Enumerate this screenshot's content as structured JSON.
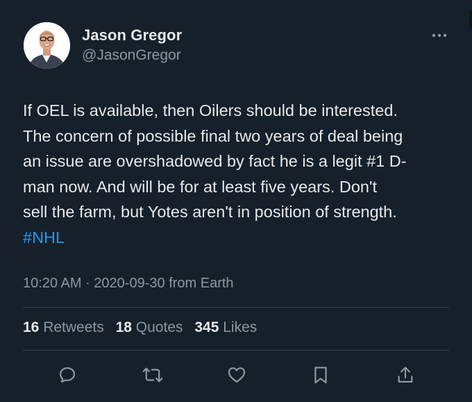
{
  "author": {
    "display_name": "Jason Gregor",
    "handle": "@JasonGregor"
  },
  "tweet": {
    "lines": [
      "If OEL is available, then Oilers should be interested.",
      "The concern of possible final two years of deal being",
      "an issue are overshadowed by fact he is a legit #1 D-",
      "man now. And will be for at least five years. Don't",
      "sell the farm, but Yotes aren't in position of strength."
    ],
    "hashtag": "#NHL"
  },
  "meta": {
    "time": "10:20 AM",
    "separator": "·",
    "date": "2020-09-30",
    "source": "from Earth"
  },
  "stats": {
    "retweets_count": "16",
    "retweets_label": "Retweets",
    "quotes_count": "18",
    "quotes_label": "Quotes",
    "likes_count": "345",
    "likes_label": "Likes"
  },
  "actions": [
    "reply-icon",
    "retweet-icon",
    "like-icon",
    "bookmark-icon",
    "share-icon"
  ],
  "colors": {
    "background": "#15202b",
    "text": "#e7e9ea",
    "secondary": "#8b98a5",
    "link": "#1d9bf0",
    "divider": "#38444d"
  }
}
